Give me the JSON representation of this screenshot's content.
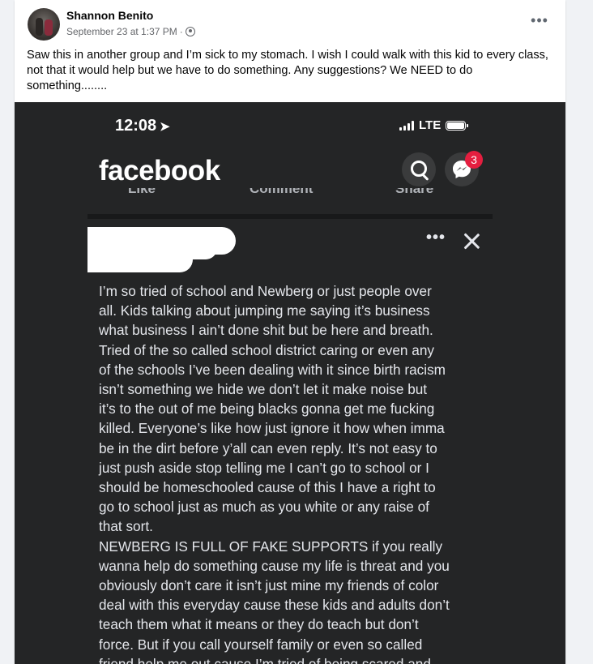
{
  "post": {
    "author": "Shannon Benito",
    "timestamp": "September 23 at 1:37 PM",
    "separator": "·",
    "privacy_icon": "globe-icon",
    "more_label": "•••",
    "text": "Saw this in another group and I’m sick to my stomach. I wish I could walk with this kid to every class, not that it would help but we have to do something. Any suggestions? We NEED to do something........"
  },
  "screenshot": {
    "status_time": "12:08",
    "location_arrow": "➤",
    "carrier": "LTE",
    "app_logo": "facebook",
    "messenger_badge": "3",
    "actions": [
      "Like",
      "Comment",
      "Share"
    ],
    "more_label": "•••",
    "body": "I’m so tried of school and Newberg or just people over\nall. Kids talking about jumping me saying it’s business\nwhat business I ain’t done shit but be here and breath.\nTried of the so called school district caring or even any\nof the schools I’ve been dealing with it since birth racism\nisn’t something we hide we don’t let it make noise but\nit’s to the out of me being blacks gonna get me fucking\nkilled. Everyone’s like how just ignore it how when imma\nbe in the dirt before y’all can even reply. It’s not easy to\njust push aside stop telling me I can’t go to school or I\nshould be homeschooled cause of this I have a right to\ngo to school just as much as you white or any raise of\nthat sort.\nNEWBERG IS FULL OF FAKE SUPPORTS if you really\nwanna help do something cause my life is threat and you\nobviously don’t care it isn’t just mine my friends of color\ndeal with this everyday cause these kids and adults don’t\nteach them what it means or they do teach but don’t\nforce. But if you call yourself family or even so called\nfriend help me out cause I’m tried of being scared and"
  },
  "colors": {
    "screenshot_bg": "#242526",
    "badge": "#e41e3f",
    "text_dark": "#050505",
    "text_secondary": "#65676b"
  }
}
